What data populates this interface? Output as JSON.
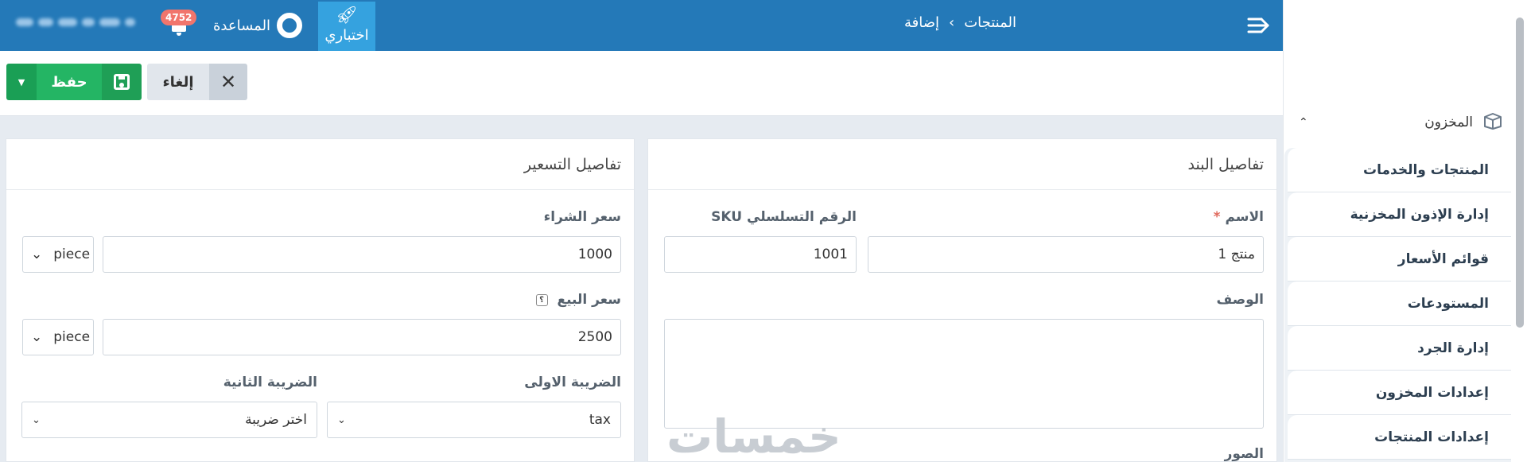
{
  "topbar": {
    "breadcrumb": [
      "المنتجات",
      "إضافة"
    ],
    "breadcrumb_separator": "›",
    "help_label": "المساعدة",
    "notifications_badge": "4752",
    "trial_label": "اختباري"
  },
  "toolbar": {
    "save_label": "حفظ",
    "cancel_label": "إلغاء"
  },
  "item_details": {
    "title": "تفاصيل البند",
    "name_label": "الاسم",
    "name_required_mark": "*",
    "name_value": "منتج 1",
    "sku_label": "الرقم التسلسلي SKU",
    "sku_value": "1001",
    "description_label": "الوصف",
    "images_label": "الصور"
  },
  "pricing_details": {
    "title": "تفاصيل التسعير",
    "purchase_price_label": "سعر الشراء",
    "purchase_price_value": "1000",
    "purchase_unit": "piece",
    "selling_price_label": "سعر البيع",
    "selling_price_help": "؟",
    "selling_price_value": "2500",
    "selling_unit": "piece",
    "tax1_label": "الضريبة الاولى",
    "tax1_value": "tax",
    "tax2_label": "الضريبة الثانية",
    "tax2_placeholder": "اختر ضريبة"
  },
  "sidebar": {
    "section_label": "المخزون",
    "items": [
      {
        "label": "المنتجات والخدمات"
      },
      {
        "label": "إدارة الإذون المخزنية"
      },
      {
        "label": "قوائم الأسعار"
      },
      {
        "label": "المستودعات"
      },
      {
        "label": "إدارة الجرد"
      },
      {
        "label": "إعدادات المخزون"
      },
      {
        "label": "إعدادات المنتجات"
      }
    ]
  },
  "watermark": "خمسات",
  "colors": {
    "topbar": "#2479b8",
    "trial": "#35a2df",
    "save": "#24b564",
    "badge": "#f1756c"
  }
}
